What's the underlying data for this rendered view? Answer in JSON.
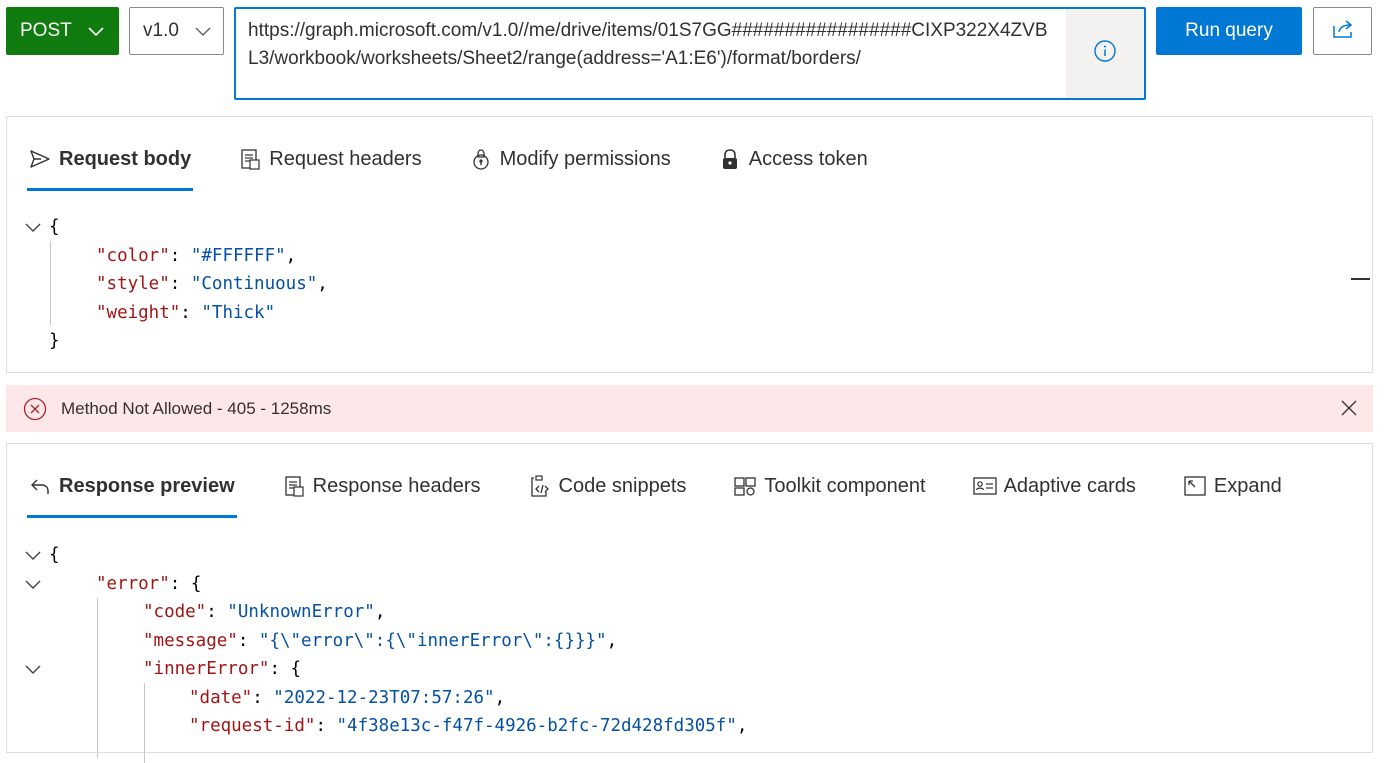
{
  "query": {
    "method": "POST",
    "version": "v1.0",
    "url": "https://graph.microsoft.com/v1.0//me/drive/items/01S7GG#################CIXP322X4ZVBL3/workbook/worksheets/Sheet2/range(address='A1:E6')/format/borders/",
    "run_label": "Run query"
  },
  "request_tabs": [
    {
      "label": "Request body",
      "icon": "send-icon"
    },
    {
      "label": "Request headers",
      "icon": "document-icon"
    },
    {
      "label": "Modify permissions",
      "icon": "permissions-icon"
    },
    {
      "label": "Access token",
      "icon": "lock-icon"
    }
  ],
  "request_body": {
    "open": "{",
    "close": "}",
    "fields": [
      {
        "key": "\"color\"",
        "value": "\"#FFFFFF\"",
        "trail": ","
      },
      {
        "key": "\"style\"",
        "value": "\"Continuous\"",
        "trail": ","
      },
      {
        "key": "\"weight\"",
        "value": "\"Thick\"",
        "trail": ""
      }
    ]
  },
  "status": {
    "message": "Method Not Allowed - 405 - 1258ms",
    "color": "#fde7e9"
  },
  "response_tabs": [
    {
      "label": "Response preview",
      "icon": "undo-icon"
    },
    {
      "label": "Response headers",
      "icon": "document-icon"
    },
    {
      "label": "Code snippets",
      "icon": "code-icon"
    },
    {
      "label": "Toolkit component",
      "icon": "toolkit-icon"
    },
    {
      "label": "Adaptive cards",
      "icon": "card-icon"
    },
    {
      "label": "Expand",
      "icon": "expand-icon"
    }
  ],
  "response_body": {
    "open": "{",
    "error_key": "\"error\"",
    "code_key": "\"code\"",
    "code_value": "\"UnknownError\"",
    "message_key": "\"message\"",
    "message_value": "\"{\\\"error\\\":{\\\"innerError\\\":{}}}\"",
    "inner_key": "\"innerError\"",
    "date_key": "\"date\"",
    "date_value": "\"2022-12-23T07:57:26\"",
    "reqid_key": "\"request-id\"",
    "reqid_value": "\"4f38e13c-f47f-4926-b2fc-72d428fd305f\""
  },
  "colors": {
    "accent": "#0078d4",
    "method_green": "#107c10",
    "json_key": "#a31515",
    "json_string": "#0451a5"
  }
}
